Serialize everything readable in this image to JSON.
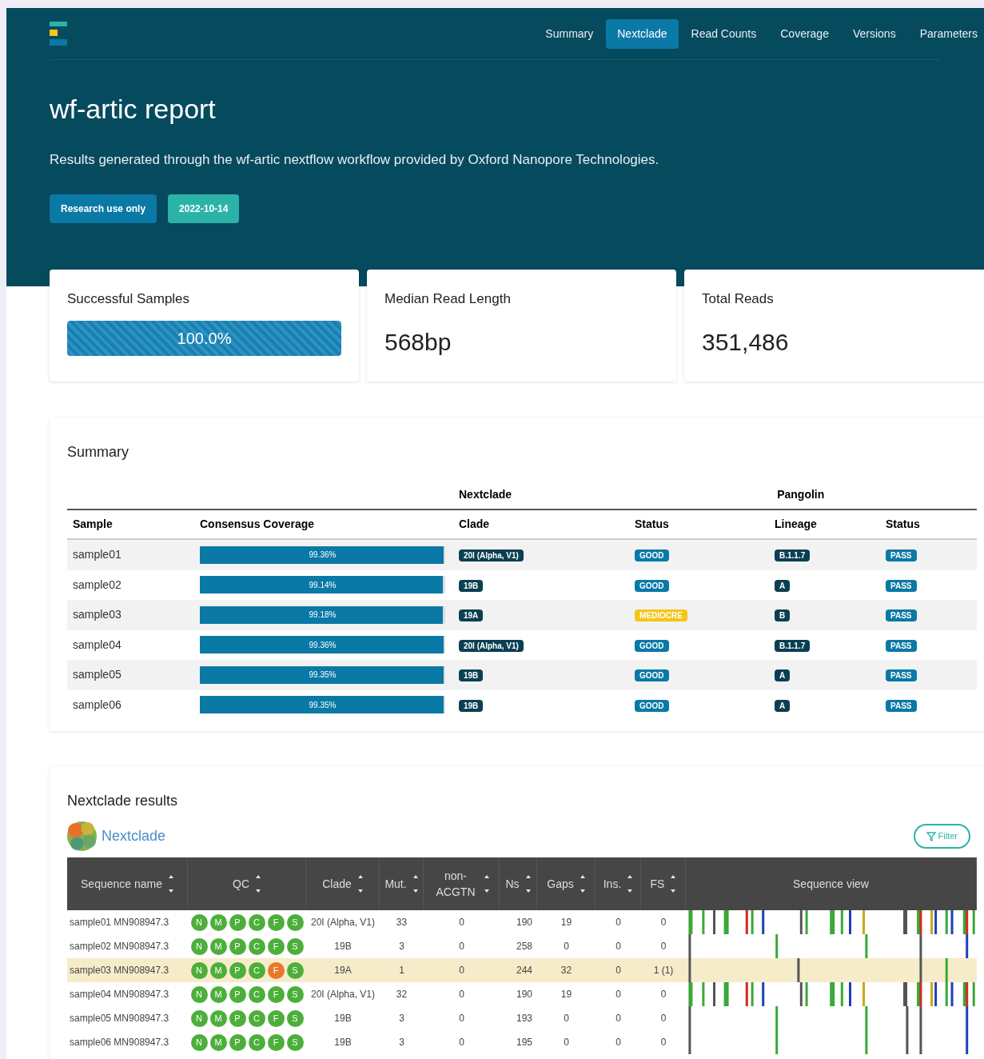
{
  "nav": {
    "tabs": [
      {
        "label": "Summary",
        "selected": false
      },
      {
        "label": "Nextclade",
        "selected": true
      },
      {
        "label": "Read Counts",
        "selected": false
      },
      {
        "label": "Coverage",
        "selected": false
      },
      {
        "label": "Versions",
        "selected": false
      },
      {
        "label": "Parameters",
        "selected": false
      }
    ]
  },
  "hero": {
    "title": "wf-artic report",
    "subtitle": "Results generated through the wf-artic nextflow workflow provided by Oxford Nanopore Technologies.",
    "badges": [
      {
        "label": "Research use only",
        "color": "#0b79a6"
      },
      {
        "label": "2022-10-14",
        "color": "#2bb3a8"
      }
    ]
  },
  "stats": [
    {
      "kind": "progress",
      "title": "Successful Samples",
      "value": "100.0%",
      "level": 1
    },
    {
      "kind": "value",
      "title": "Median Read Length",
      "value": "568bp"
    },
    {
      "kind": "value",
      "title": "Total Reads",
      "value": "351,486"
    }
  ],
  "summary": {
    "title": "Summary",
    "group_nextclade": "Nextclade",
    "group_pangolin": "Pangolin",
    "columns": [
      "Sample",
      "Consensus Coverage",
      "Clade",
      "Status",
      "Lineage",
      "Status"
    ],
    "rows": [
      {
        "sample": "sample01",
        "coverage": "99.36%",
        "level": 0.9936,
        "clade": "20I (Alpha, V1)",
        "status": "GOOD",
        "mediocre": false,
        "lineage": "B.1.1.7",
        "pangolin_status": "PASS"
      },
      {
        "sample": "sample02",
        "coverage": "99.14%",
        "level": 0.9914,
        "clade": "19B",
        "status": "GOOD",
        "mediocre": false,
        "lineage": "A",
        "pangolin_status": "PASS"
      },
      {
        "sample": "sample03",
        "coverage": "99.18%",
        "level": 0.9918,
        "clade": "19A",
        "status": "MEDIOCRE",
        "mediocre": true,
        "lineage": "B",
        "pangolin_status": "PASS"
      },
      {
        "sample": "sample04",
        "coverage": "99.36%",
        "level": 0.9936,
        "clade": "20I (Alpha, V1)",
        "status": "GOOD",
        "mediocre": false,
        "lineage": "B.1.1.7",
        "pangolin_status": "PASS"
      },
      {
        "sample": "sample05",
        "coverage": "99.35%",
        "level": 0.9935,
        "clade": "19B",
        "status": "GOOD",
        "mediocre": false,
        "lineage": "A",
        "pangolin_status": "PASS"
      },
      {
        "sample": "sample06",
        "coverage": "99.35%",
        "level": 0.9935,
        "clade": "19B",
        "status": "GOOD",
        "mediocre": false,
        "lineage": "A",
        "pangolin_status": "PASS"
      }
    ]
  },
  "nextclade": {
    "title": "Nextclade results",
    "logo_text": "Nextclade",
    "filter_button": "Filter",
    "columns": [
      "Sequence name",
      "QC",
      "Clade",
      "Mut.",
      "non-ACGTN",
      "Ns",
      "Gaps",
      "Ins.",
      "FS",
      "Sequence view"
    ],
    "rows": [
      {
        "name": "sample01 MN908947.3",
        "warning": false,
        "qc": [
          {
            "label": "N",
            "kind": "good"
          },
          {
            "label": "M",
            "kind": "good"
          },
          {
            "label": "P",
            "kind": "good"
          },
          {
            "label": "C",
            "kind": "good"
          },
          {
            "label": "F",
            "kind": "good"
          },
          {
            "label": "S",
            "kind": "good"
          }
        ],
        "clade": "20I (Alpha, V1)",
        "mut": "33",
        "non_acgtn": "0",
        "ns": "190",
        "gaps": "19",
        "ins": "0",
        "fs": "0"
      },
      {
        "name": "sample02 MN908947.3",
        "warning": false,
        "qc": [
          {
            "label": "N",
            "kind": "good"
          },
          {
            "label": "M",
            "kind": "good"
          },
          {
            "label": "P",
            "kind": "good"
          },
          {
            "label": "C",
            "kind": "good"
          },
          {
            "label": "F",
            "kind": "good"
          },
          {
            "label": "S",
            "kind": "good"
          }
        ],
        "clade": "19B",
        "mut": "3",
        "non_acgtn": "0",
        "ns": "258",
        "gaps": "0",
        "ins": "0",
        "fs": "0"
      },
      {
        "name": "sample03 MN908947.3",
        "warning": true,
        "qc": [
          {
            "label": "N",
            "kind": "good"
          },
          {
            "label": "M",
            "kind": "good"
          },
          {
            "label": "P",
            "kind": "good"
          },
          {
            "label": "C",
            "kind": "good"
          },
          {
            "label": "F",
            "kind": "mediocre"
          },
          {
            "label": "S",
            "kind": "good"
          }
        ],
        "clade": "19A",
        "mut": "1",
        "non_acgtn": "0",
        "ns": "244",
        "gaps": "32",
        "ins": "0",
        "fs": "1 (1)"
      },
      {
        "name": "sample04 MN908947.3",
        "warning": false,
        "qc": [
          {
            "label": "N",
            "kind": "good"
          },
          {
            "label": "M",
            "kind": "good"
          },
          {
            "label": "P",
            "kind": "good"
          },
          {
            "label": "C",
            "kind": "good"
          },
          {
            "label": "F",
            "kind": "good"
          },
          {
            "label": "S",
            "kind": "good"
          }
        ],
        "clade": "20I (Alpha, V1)",
        "mut": "32",
        "non_acgtn": "0",
        "ns": "190",
        "gaps": "19",
        "ins": "0",
        "fs": "0"
      },
      {
        "name": "sample05 MN908947.3",
        "warning": false,
        "qc": [
          {
            "label": "N",
            "kind": "good"
          },
          {
            "label": "M",
            "kind": "good"
          },
          {
            "label": "P",
            "kind": "good"
          },
          {
            "label": "C",
            "kind": "good"
          },
          {
            "label": "F",
            "kind": "good"
          },
          {
            "label": "S",
            "kind": "good"
          }
        ],
        "clade": "19B",
        "mut": "3",
        "non_acgtn": "0",
        "ns": "193",
        "gaps": "0",
        "ins": "0",
        "fs": "0"
      },
      {
        "name": "sample06 MN908947.3",
        "warning": false,
        "qc": [
          {
            "label": "N",
            "kind": "good"
          },
          {
            "label": "M",
            "kind": "good"
          },
          {
            "label": "P",
            "kind": "good"
          },
          {
            "label": "C",
            "kind": "good"
          },
          {
            "label": "F",
            "kind": "good"
          },
          {
            "label": "S",
            "kind": "good"
          }
        ],
        "clade": "19B",
        "mut": "3",
        "non_acgtn": "0",
        "ns": "195",
        "gaps": "0",
        "ins": "0",
        "fs": "0"
      }
    ]
  }
}
